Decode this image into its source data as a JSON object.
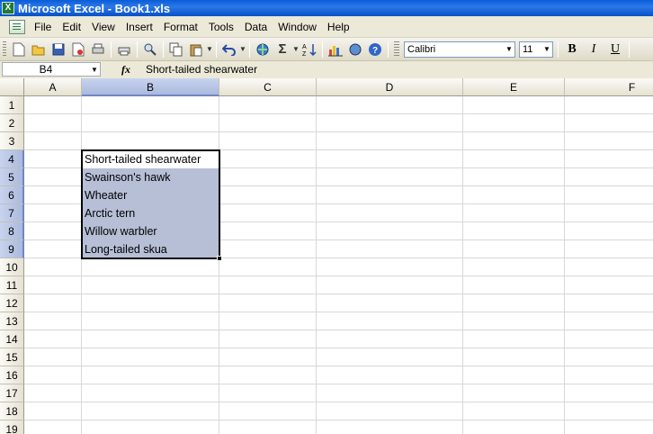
{
  "window": {
    "title": "Microsoft Excel - Book1.xls",
    "app_icon": "excel-icon"
  },
  "menu": [
    "File",
    "Edit",
    "View",
    "Insert",
    "Format",
    "Tools",
    "Data",
    "Window",
    "Help"
  ],
  "menu_underlines": [
    "F",
    "E",
    "V",
    "I",
    "o",
    "T",
    "D",
    "W",
    "H"
  ],
  "toolbar": {
    "font_name": "Calibri",
    "font_size": "11",
    "bold": "B",
    "italic": "I",
    "underline": "U",
    "sum_symbol": "Σ"
  },
  "formula_bar": {
    "name_box": "B4",
    "fx_label": "fx",
    "content": "Short-tailed shearwater"
  },
  "columns": [
    "A",
    "B",
    "C",
    "D",
    "E",
    "F"
  ],
  "rows": [
    "1",
    "2",
    "3",
    "4",
    "5",
    "6",
    "7",
    "8",
    "9",
    "10",
    "11",
    "12",
    "13",
    "14",
    "15",
    "16",
    "17",
    "18",
    "19"
  ],
  "selection": {
    "active_cell": "B4",
    "range": "B4:B9",
    "selected_column": "B"
  },
  "cells": {
    "B4": "Short-tailed shearwater",
    "B5": "Swainson's hawk",
    "B6": "Wheater",
    "B7": "Arctic tern",
    "B8": "Willow warbler",
    "B9": "Long-tailed skua"
  }
}
